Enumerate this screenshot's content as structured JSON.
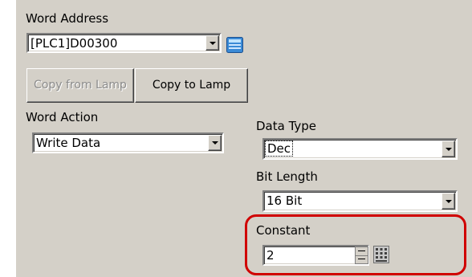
{
  "word_address": {
    "label": "Word Address",
    "value": "[PLC1]D00300",
    "icon": "device-keypad-icon"
  },
  "lamp_buttons": {
    "copy_from_lamp": "Copy from Lamp",
    "copy_to_lamp": "Copy to Lamp"
  },
  "word_action": {
    "label": "Word Action",
    "value": "Write Data"
  },
  "data_type": {
    "label": "Data Type",
    "value": "Dec"
  },
  "bit_length": {
    "label": "Bit Length",
    "value": "16 Bit"
  },
  "constant": {
    "label": "Constant",
    "value": "2",
    "spin_icon": "spin-updown-icon",
    "keypad_icon": "keypad-icon"
  },
  "colors": {
    "panel": "#d4d0c8",
    "highlight": "#d00000",
    "disabled_text": "#8c8c8c"
  }
}
